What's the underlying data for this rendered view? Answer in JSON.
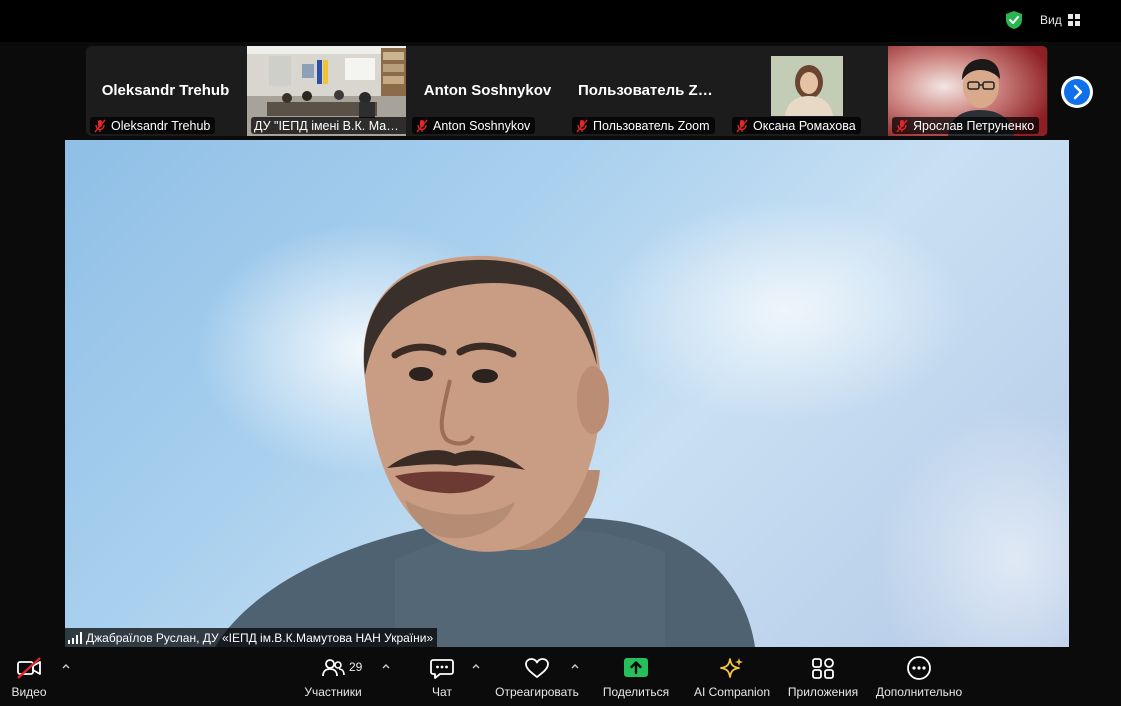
{
  "top_bar": {
    "view_label": "Вид",
    "shield_color": "#2bb551"
  },
  "gallery": {
    "tiles": [
      {
        "display_name": "Oleksandr Trehub",
        "tag": "Oleksandr Trehub",
        "video": false
      },
      {
        "display_name": "",
        "tag": "ДУ \"ІЕПД імені В.К. Мамутова НАН України\"",
        "video": true
      },
      {
        "display_name": "Anton Soshnykov",
        "tag": "Anton Soshnykov",
        "video": false
      },
      {
        "display_name": "Пользователь Zoom",
        "tag": "Пользователь Zoom",
        "video": false
      },
      {
        "display_name": "",
        "tag": "Оксана Ромахова",
        "video": true
      },
      {
        "display_name": "",
        "tag": "Ярослав Петруненко",
        "video": true
      }
    ]
  },
  "main_video": {
    "speaker_tag": "Джабраїлов Руслан, ДУ «ІЕПД ім.В.К.Мамутова НАН України»"
  },
  "toolbar": {
    "video_label": "Видео",
    "participants_label": "Участники",
    "participants_count": "29",
    "chat_label": "Чат",
    "react_label": "Отреагировать",
    "share_label": "Поделиться",
    "ai_label": "AI Companion",
    "apps_label": "Приложения",
    "more_label": "Дополнительно",
    "share_color": "#25c05b",
    "ai_color": "#f4c542",
    "mute_color": "#e5252a"
  }
}
